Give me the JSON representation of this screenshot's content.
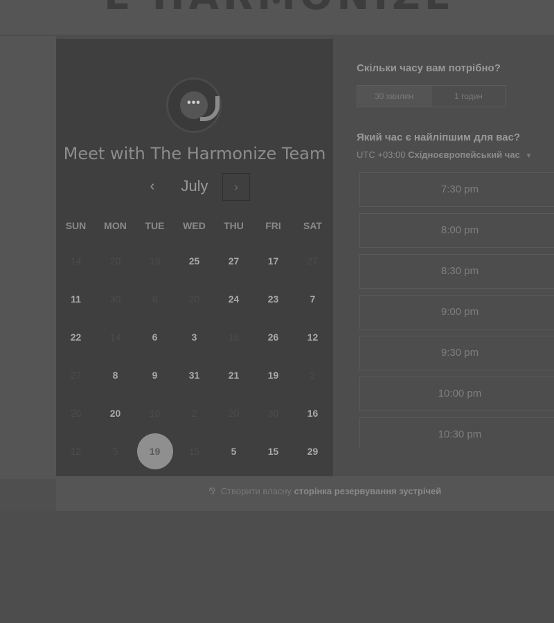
{
  "brand": {
    "fragment": "E HARMONIZE"
  },
  "calendar": {
    "title": "Meet with The Harmonize Team",
    "month": "July",
    "prev_icon": "‹",
    "next_icon": "›",
    "weekdays": [
      "SUN",
      "MON",
      "TUE",
      "WED",
      "THU",
      "FRI",
      "SAT"
    ],
    "weeks": [
      [
        {
          "d": "14",
          "s": "na"
        },
        {
          "d": "20",
          "s": "na"
        },
        {
          "d": "13",
          "s": "na"
        },
        {
          "d": "25",
          "s": "avail"
        },
        {
          "d": "27",
          "s": "avail"
        },
        {
          "d": "17",
          "s": "avail"
        },
        {
          "d": "27",
          "s": "na"
        }
      ],
      [
        {
          "d": "11",
          "s": "avail"
        },
        {
          "d": "30",
          "s": "na"
        },
        {
          "d": "8",
          "s": "na"
        },
        {
          "d": "20",
          "s": "na"
        },
        {
          "d": "24",
          "s": "avail"
        },
        {
          "d": "23",
          "s": "avail"
        },
        {
          "d": "7",
          "s": "avail"
        }
      ],
      [
        {
          "d": "22",
          "s": "avail"
        },
        {
          "d": "14",
          "s": "na"
        },
        {
          "d": "6",
          "s": "avail"
        },
        {
          "d": "3",
          "s": "avail"
        },
        {
          "d": "16",
          "s": "na"
        },
        {
          "d": "26",
          "s": "avail"
        },
        {
          "d": "12",
          "s": "avail"
        }
      ],
      [
        {
          "d": "27",
          "s": "na"
        },
        {
          "d": "8",
          "s": "avail"
        },
        {
          "d": "9",
          "s": "avail"
        },
        {
          "d": "31",
          "s": "avail"
        },
        {
          "d": "21",
          "s": "avail"
        },
        {
          "d": "19",
          "s": "avail"
        },
        {
          "d": "2",
          "s": "na"
        }
      ],
      [
        {
          "d": "20",
          "s": "na"
        },
        {
          "d": "20",
          "s": "avail"
        },
        {
          "d": "10",
          "s": "na"
        },
        {
          "d": "2",
          "s": "na"
        },
        {
          "d": "20",
          "s": "na"
        },
        {
          "d": "30",
          "s": "na"
        },
        {
          "d": "16",
          "s": "avail"
        }
      ],
      [
        {
          "d": "12",
          "s": "na"
        },
        {
          "d": "5",
          "s": "na"
        },
        {
          "d": "19",
          "s": "sel"
        },
        {
          "d": "15",
          "s": "na"
        },
        {
          "d": "5",
          "s": "avail"
        },
        {
          "d": "15",
          "s": "avail"
        },
        {
          "d": "29",
          "s": "avail"
        }
      ]
    ]
  },
  "booking": {
    "duration_question": "Скільки часу вам потрібно?",
    "durations": [
      "30 хвилин",
      "1 годин"
    ],
    "time_question": "Який час є найліпшим для вас?",
    "timezone_offset": "UTC +03:00",
    "timezone_name": "Східноєвропейський час",
    "slots": [
      "7:30 pm",
      "8:00 pm",
      "8:30 pm",
      "9:00 pm",
      "9:30 pm",
      "10:00 pm",
      "10:30 pm"
    ]
  },
  "footer": {
    "prefix": "Створити власну",
    "bold": "сторінка резервування зустрічей"
  },
  "colors": {
    "background": "#4d4d4d",
    "calendar_panel": "#3f3f3f",
    "selected_day": "#8f8f8f"
  }
}
